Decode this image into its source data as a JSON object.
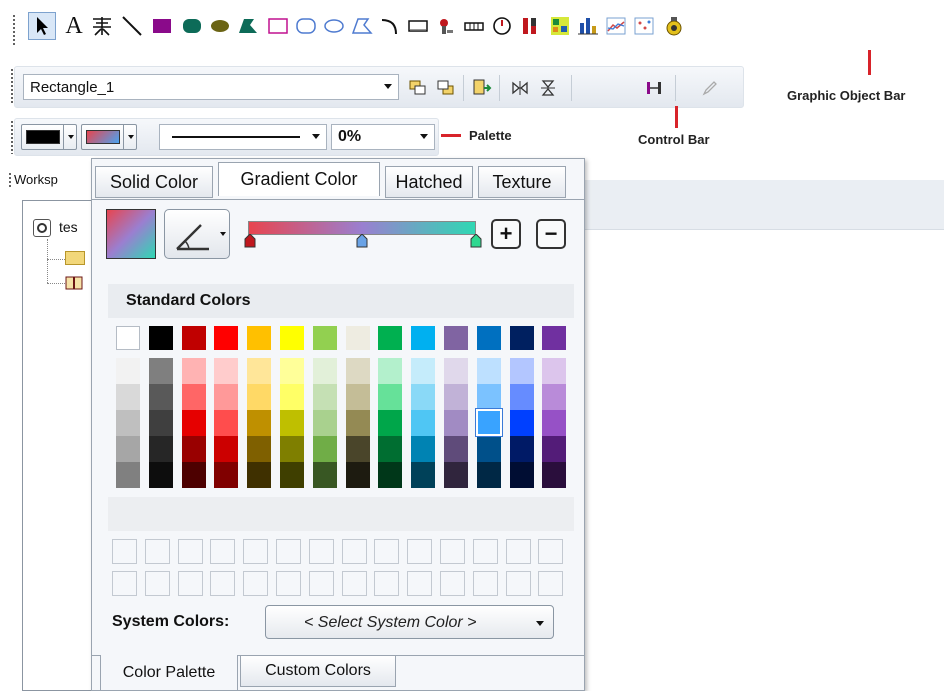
{
  "graphic_object_bar": {
    "tools": [
      "pointer-tool",
      "text-tool",
      "special-text-tool",
      "line-tool",
      "rectangle-tool",
      "rounded-rectangle-tool",
      "ellipse-tool",
      "polygon-tool",
      "empty-rectangle-tool",
      "empty-rounded-rectangle-tool",
      "empty-ellipse-tool",
      "empty-polygon-tool",
      "arc-tool",
      "button-tool",
      "valve-tool",
      "pipe-tool",
      "gauge-tool",
      "level-bar-tool",
      "mimic-tool",
      "bar-chart-tool",
      "trend-chart-tool",
      "xy-chart-tool",
      "alarm-tool"
    ],
    "text_tool_label": "A",
    "annotation": "Graphic Object Bar"
  },
  "control_bar": {
    "object_name": "Rectangle_1",
    "annotation": "Control Bar"
  },
  "palette_bar": {
    "transparency": "0%",
    "annotation": "Palette"
  },
  "workspace": {
    "title": "Worksp",
    "tree_root": "tes"
  },
  "color_popup": {
    "tabs": [
      "Solid Color",
      "Gradient Color",
      "Hatched",
      "Texture"
    ],
    "active_tab": "Gradient Color",
    "gradient": {
      "start_color": "#e8454f",
      "mid_color": "#9a7fd0",
      "end_color": "#2fd8b3"
    },
    "standard_colors_label": "Standard Colors",
    "system_colors_label": "System Colors:",
    "system_color_placeholder": "< Select System Color >",
    "bottom_tabs": [
      "Color Palette",
      "Custom Colors"
    ],
    "active_bottom_tab": "Color Palette",
    "base_colors": [
      "#ffffff",
      "#000000",
      "#c00000",
      "#ff0000",
      "#ffc000",
      "#ffff00",
      "#92d050",
      "#eeece1",
      "#00b050",
      "#00b0f0",
      "#8064a2",
      "#0070c0",
      "#002060",
      "#7030a0"
    ],
    "shade_columns": [
      [
        "#f2f2f2",
        "#d9d9d9",
        "#bfbfbf",
        "#a6a6a6",
        "#808080"
      ],
      [
        "#7f7f7f",
        "#595959",
        "#3f3f3f",
        "#262626",
        "#0d0d0d"
      ],
      [
        "#ffb3b3",
        "#ff6666",
        "#e60000",
        "#990000",
        "#4d0000"
      ],
      [
        "#ffcccc",
        "#ff9999",
        "#ff4d4d",
        "#cc0000",
        "#800000"
      ],
      [
        "#ffe699",
        "#ffd966",
        "#bf9000",
        "#7f6000",
        "#3f3000"
      ],
      [
        "#ffff99",
        "#ffff66",
        "#bfbf00",
        "#7f7f00",
        "#3f3f00"
      ],
      [
        "#e2f0d9",
        "#c5e0b4",
        "#a9d18e",
        "#70ad47",
        "#385723"
      ],
      [
        "#ddd9c3",
        "#c4bd97",
        "#948a54",
        "#4a452a",
        "#1d1b10"
      ],
      [
        "#b3f0cc",
        "#66e199",
        "#00a64a",
        "#006e31",
        "#003719"
      ],
      [
        "#c5ecfb",
        "#8ad9f7",
        "#4fc6f4",
        "#0083b3",
        "#004159"
      ],
      [
        "#e0d8eb",
        "#c1b2d7",
        "#a18bc3",
        "#5f4b7a",
        "#30253d"
      ],
      [
        "#bde0ff",
        "#7bc2ff",
        "#39a3ff",
        "#00508a",
        "#002845"
      ],
      [
        "#b3c6ff",
        "#668cff",
        "#0040ff",
        "#001a66",
        "#000d33"
      ],
      [
        "#dcc5ec",
        "#b98bd9",
        "#9651c6",
        "#531c78",
        "#2a0e3c"
      ]
    ]
  }
}
